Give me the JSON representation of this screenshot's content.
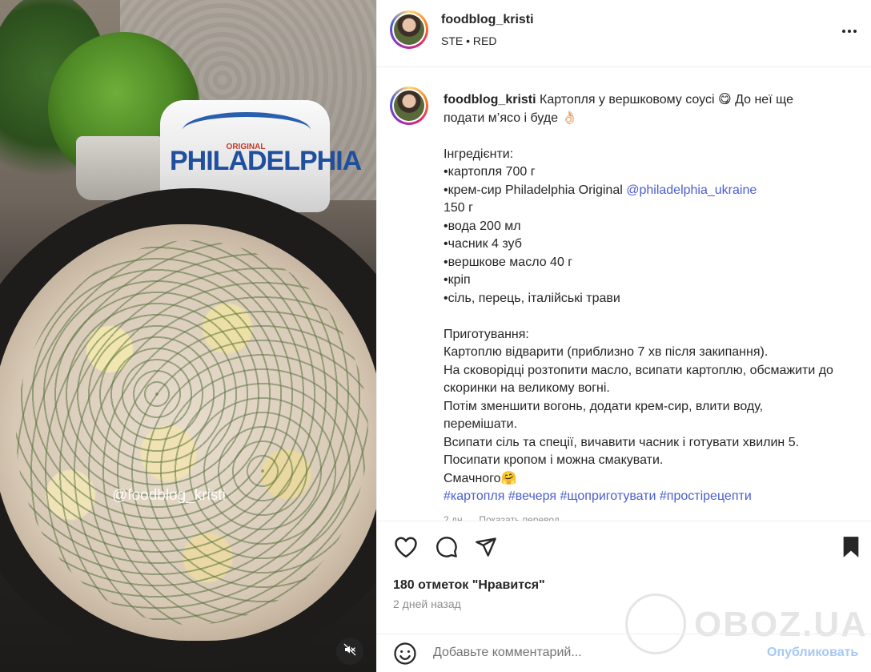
{
  "media": {
    "handle_overlay": "@foodblog_kristi",
    "product_label": "PHILADELPHIA",
    "product_sublabel": "ORIGINAL",
    "mute_icon": "speaker-muted-icon"
  },
  "header": {
    "username": "foodblog_kristi",
    "subtitle": "STE • RED",
    "more_icon": "more-horizontal-icon"
  },
  "caption": {
    "username": "foodblog_kristi",
    "intro_line": " Картопля у вершковому соусі 😋  До неї ще подати м’ясо і буде 👌🏻",
    "ingredients_title": "Інгредієнти:",
    "ing_1": "•картопля 700 г",
    "ing_2_text": "•крем-сир Philadelphia Original ",
    "ing_2_mention": "@philadelphia_ukraine",
    "ing_2_cont": "150 г",
    "ing_3": "•вода 200 мл",
    "ing_4": "•часник 4 зуб",
    "ing_5": "•вершкове масло 40 г",
    "ing_6": "•кріп",
    "ing_7": "•сіль, перець, італійські трави",
    "method_title": "Приготування:",
    "m_1": "Картоплю відварити (приблизно 7 хв після закипання).",
    "m_2": "На сковорідці розтопити масло, всипати картоплю, обсмажити до скоринки на великому вогні.",
    "m_3": "Потім зменшити вогонь, додати крем-сир, влити воду, перемішати.",
    "m_4": "Всипати сіль та спеції, вичавити часник і готувати хвилин 5.",
    "m_5": "Посипати кропом і можна смакувати.",
    "m_6": "Смачного🤗",
    "hashtags": "#картопля #вечеря #щоприготувати #простірецепти",
    "time_ago": "2 дн.",
    "translate": "Показать перевод"
  },
  "actions": {
    "like_icon": "heart-icon",
    "comment_icon": "comment-icon",
    "share_icon": "paper-plane-icon",
    "save_icon": "bookmark-icon",
    "likes_text": "180 отметок \"Нравится\"",
    "date_text": "2 дней назад"
  },
  "comment": {
    "emoji_icon": "smiley-icon",
    "placeholder": "Добавьте комментарий...",
    "post_label": "Опубликовать"
  },
  "watermark": {
    "text": "OBOZ.UA"
  },
  "colors": {
    "link": "#4a5ecf",
    "post_button": "#a6c8f5",
    "muted_text": "#8e8e8e"
  }
}
